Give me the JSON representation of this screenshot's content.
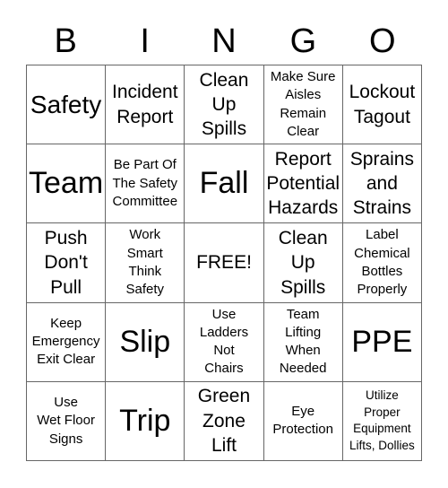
{
  "header": [
    "B",
    "I",
    "N",
    "G",
    "O"
  ],
  "cells": [
    {
      "text": "Safety",
      "size": "lg"
    },
    {
      "text": "Incident\nReport",
      "size": "md"
    },
    {
      "text": "Clean\nUp\nSpills",
      "size": "md"
    },
    {
      "text": "Make Sure\nAisles\nRemain\nClear",
      "size": "sm"
    },
    {
      "text": "Lockout\nTagout",
      "size": "md"
    },
    {
      "text": "Team",
      "size": "xl"
    },
    {
      "text": "Be Part Of\nThe Safety\nCommittee",
      "size": "sm"
    },
    {
      "text": "Fall",
      "size": "xl"
    },
    {
      "text": "Report\nPotential\nHazards",
      "size": "md"
    },
    {
      "text": "Sprains\nand\nStrains",
      "size": "md"
    },
    {
      "text": "Push\nDon't\nPull",
      "size": "md"
    },
    {
      "text": "Work\nSmart\nThink\nSafety",
      "size": "sm"
    },
    {
      "text": "FREE!",
      "size": "md"
    },
    {
      "text": "Clean\nUp\nSpills",
      "size": "md"
    },
    {
      "text": "Label\nChemical\nBottles\nProperly",
      "size": "sm"
    },
    {
      "text": "Keep\nEmergency\nExit Clear",
      "size": "sm"
    },
    {
      "text": "Slip",
      "size": "xl"
    },
    {
      "text": "Use\nLadders\nNot\nChairs",
      "size": "sm"
    },
    {
      "text": "Team\nLifting\nWhen\nNeeded",
      "size": "sm"
    },
    {
      "text": "PPE",
      "size": "xl"
    },
    {
      "text": "Use\nWet Floor\nSigns",
      "size": "sm"
    },
    {
      "text": "Trip",
      "size": "xl"
    },
    {
      "text": "Green\nZone\nLift",
      "size": "md"
    },
    {
      "text": "Eye\nProtection",
      "size": "sm"
    },
    {
      "text": "Utilize\nProper\nEquipment\nLifts, Dollies",
      "size": "xs"
    }
  ]
}
